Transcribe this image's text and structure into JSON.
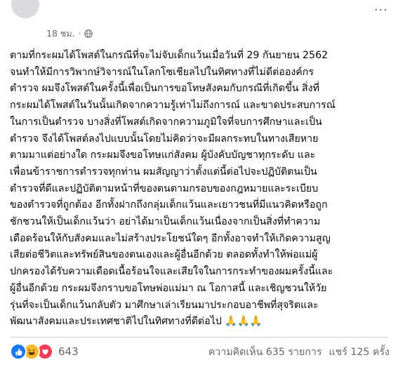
{
  "post": {
    "timestamp": "18 ชม.",
    "separator": "·",
    "more_label": "···",
    "text": "ตามที่กระผมได้โพสต์ในกรณีที่จะไม่จับเด็กแว้นเมื่อวันที่ 29 กันยายน 2562\nจนทำให้มีการวิพากษ์วิจารณ์ในโลกโซเชียลไปในทิศทางที่ไม่ดีต่อองค์กร\nตำรวจ ผมจึงโพสต์ในครั้งนี้เพื่อเป็นการขอโทษสังคมกับกรณีที่เกิดขึ้น สิ่งที่\nกระผมได้โพสต์ในวันนั้นเกิดจากความรู้เท่าไม่ถึงการณ์ และขาดประสบการณ์\nในการเป็นตำรวจ บางสิ่งที่โพสต์เกิดจากความภูมิใจที่จบการศึกษาและเป็น\nตำรวจ จึงได้โพสต์ลงไปแบบนั้นโดยไม่คิดว่าจะมีผลกระทบในทางเสียหาย\nตามมาแต่อย่างใด กระผมจึงขอโทษแก่สังคม ผู้บังคับบัญชาทุกระดับ และ\nเพื่อนข้าราชการตำรวจทุกท่าน ผมสัญญาว่าตั้งแต่นี้ต่อไปจะปฏิบัติตนเป็น\nตำรวจที่ดีและปฏิบัติตามหน้าที่ของตนตามกรอบของกฎหมายและระเบียบ\nของตำรวจที่ถูกต้อง อีกทั้งฝากถึงกลุ่มเด็กแว้นและเยาวชนที่มีแนวคิดหรือถูก\nชักชวนให้เป็นเด็กแว้นว่า อย่าได้มาเป็นเด็กแว้นเนื่องจากเป็นสิ่งที่ทำความ\nเดือดร้อนให้กับสังคมและไม่สร้างประโยชน์ใดๆ อีกทั้งอาจทำให้เกิดความสูญ\nเสียต่อชีวิตและทรัพย์สินของตนเองและผู้อื่นอีกด้วย ตลอดทั้งทำให้พ่อแม่ผู้\nปกครองได้รับความเดือดเนื้อร้อนใจและเสียใจในการกระทำของผมครั้งนี้และ\nผู้อื่นอีกด้วย กระผมจึงกราบขอโทษพ่อแม่มา ณ โอกาสนี้ และเชิญชวนให้วัย\nรุ่นที่จะเป็นเด็กแว้นกลับตัว มาศึกษาเล่าเรียนมาประกอบอาชีพที่สุจริตและ\nพัฒนาสังคมและประเทศชาติไปในทิศทางที่ดีต่อไป 🙏🙏🙏"
  },
  "footer": {
    "reaction_count": "643",
    "reactions": [
      "like-icon",
      "haha-icon",
      "love-icon"
    ],
    "comments": "ความคิดเห็น 635 รายการ",
    "shares": "แชร์ 125 ครั้ง"
  },
  "colors": {
    "text": "#050505",
    "secondary": "#65676b",
    "like": "#1877f2",
    "haha": "#f7b928",
    "love": "#f33e58",
    "divider": "#ced0d4"
  }
}
